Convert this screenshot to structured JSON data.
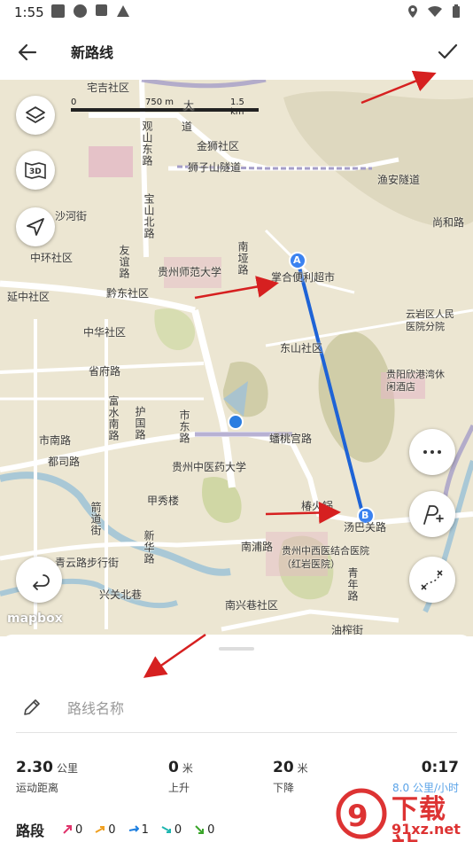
{
  "status_bar": {
    "time": "1:55"
  },
  "header": {
    "title": "新路线"
  },
  "map": {
    "scale": {
      "zero": "0",
      "mid": "750 m",
      "end": "1.5 km"
    },
    "attribution": "mapbox",
    "labels": [
      {
        "text": "宅吉社区"
      },
      {
        "text": "大"
      },
      {
        "text": "道"
      },
      {
        "text": "观山东路"
      },
      {
        "text": "金狮社区"
      },
      {
        "text": "狮子山隧道"
      },
      {
        "text": "渔安隧道"
      },
      {
        "text": "宝山北路"
      },
      {
        "text": "沙河街"
      },
      {
        "text": "尚和路"
      },
      {
        "text": "中环社区"
      },
      {
        "text": "友谊路"
      },
      {
        "text": "贵州师范大学"
      },
      {
        "text": "黔东社区"
      },
      {
        "text": "延中社区"
      },
      {
        "text": "南垭路"
      },
      {
        "text": "掌合便利超市"
      },
      {
        "text": "云岩区人民医院分院"
      },
      {
        "text": "中华社区"
      },
      {
        "text": "东山社区"
      },
      {
        "text": "省府路"
      },
      {
        "text": "贵阳欣港湾休闲酒店"
      },
      {
        "text": "富水南路"
      },
      {
        "text": "护国路"
      },
      {
        "text": "市东路"
      },
      {
        "text": "蟠桃宫路"
      },
      {
        "text": "都司路"
      },
      {
        "text": "贵州中医药大学"
      },
      {
        "text": "甲秀楼"
      },
      {
        "text": "椿火锅"
      },
      {
        "text": "箭道街"
      },
      {
        "text": "汤巴关路"
      },
      {
        "text": "新华路"
      },
      {
        "text": "南浦路"
      },
      {
        "text": "贵州中西医结合医院（红岩医院）"
      },
      {
        "text": "青云路步行街"
      },
      {
        "text": "兴关北巷"
      },
      {
        "text": "南兴巷社区"
      },
      {
        "text": "油榨街"
      },
      {
        "text": "青年路"
      },
      {
        "text": "市南路"
      }
    ],
    "markers": {
      "a": "A",
      "b": "B"
    }
  },
  "route": {
    "name_placeholder": "路线名称",
    "distance": {
      "value": "2.30",
      "unit": "公里",
      "label": "运动距离"
    },
    "ascent": {
      "value": "0",
      "unit": "米",
      "label": "上升"
    },
    "descent": {
      "value": "20",
      "unit": "米",
      "label": "下降"
    },
    "time": {
      "value": "0:17",
      "speed": "8.0 公里/小时"
    }
  },
  "segments": {
    "title": "路段",
    "items": [
      {
        "color": "#e0336b",
        "count": "0"
      },
      {
        "color": "#f0a020",
        "count": "0"
      },
      {
        "color": "#1e7fe0",
        "count": "1"
      },
      {
        "color": "#1fb6b0",
        "count": "0"
      },
      {
        "color": "#3aa52a",
        "count": "0"
      }
    ]
  },
  "watermark": {
    "brand": "下载站",
    "url": "91xz.net"
  }
}
